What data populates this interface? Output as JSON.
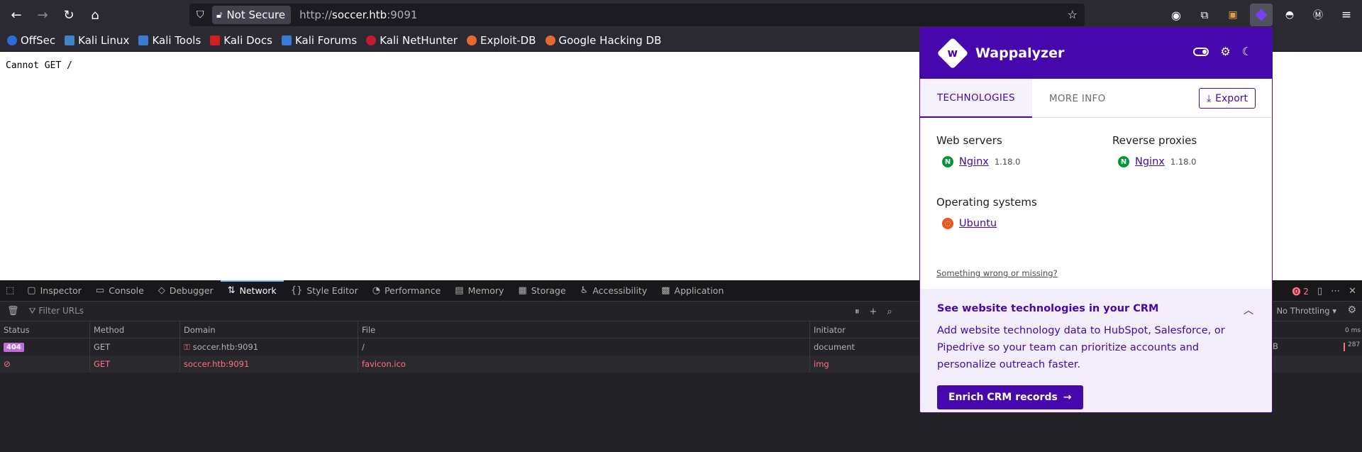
{
  "browser": {
    "security_label": "Not Secure",
    "url_scheme": "http://",
    "url_host": "soccer.htb",
    "url_port": ":9091"
  },
  "bookmarks": [
    {
      "label": "OffSec",
      "color": "#2b6cd8"
    },
    {
      "label": "Kali Linux",
      "color": "#3d85c6"
    },
    {
      "label": "Kali Tools",
      "color": "#3a7bd5"
    },
    {
      "label": "Kali Docs",
      "color": "#d02020"
    },
    {
      "label": "Kali Forums",
      "color": "#3a7bd5"
    },
    {
      "label": "Kali NetHunter",
      "color": "#c21b2d"
    },
    {
      "label": "Exploit-DB",
      "color": "#e86a2a"
    },
    {
      "label": "Google Hacking DB",
      "color": "#e86a2a"
    }
  ],
  "page": {
    "text": "Cannot GET /"
  },
  "devtools": {
    "tabs": [
      {
        "label": "Inspector",
        "icon": "inspector-icon",
        "glyph": "▢"
      },
      {
        "label": "Console",
        "icon": "console-icon",
        "glyph": "▭"
      },
      {
        "label": "Debugger",
        "icon": "debugger-icon",
        "glyph": "◇"
      },
      {
        "label": "Network",
        "icon": "network-icon",
        "glyph": "⇅"
      },
      {
        "label": "Style Editor",
        "icon": "style-editor-icon",
        "glyph": "{}"
      },
      {
        "label": "Performance",
        "icon": "performance-icon",
        "glyph": "◔"
      },
      {
        "label": "Memory",
        "icon": "memory-icon",
        "glyph": "▤"
      },
      {
        "label": "Storage",
        "icon": "storage-icon",
        "glyph": "▦"
      },
      {
        "label": "Accessibility",
        "icon": "accessibility-icon",
        "glyph": "♿"
      },
      {
        "label": "Application",
        "icon": "application-icon",
        "glyph": "▩"
      }
    ],
    "selected_tab": "Network",
    "error_count": "2",
    "filter_placeholder": "Filter URLs",
    "throttling": "No Throttling",
    "waterfall_label": "0 ms",
    "columns": [
      "Status",
      "Method",
      "Domain",
      "File",
      "Initiator"
    ],
    "rows": [
      {
        "status": "404",
        "method": "GET",
        "domain": "soccer.htb:9091",
        "file": "/",
        "initiator": "document",
        "type_tail": "B",
        "size_tail": "287"
      },
      {
        "status": "blocked",
        "method": "GET",
        "domain": "soccer.htb:9091",
        "file": "favicon.ico",
        "initiator": "img"
      }
    ]
  },
  "wappalyzer": {
    "title": "Wappalyzer",
    "tabs": [
      "TECHNOLOGIES",
      "MORE INFO"
    ],
    "export_label": "Export",
    "categories": [
      {
        "name": "Web servers",
        "tech": "Nginx",
        "version": "1.18.0",
        "color": "#009639"
      },
      {
        "name": "Reverse proxies",
        "tech": "Nginx",
        "version": "1.18.0",
        "color": "#009639"
      },
      {
        "name": "Operating systems",
        "tech": "Ubuntu",
        "version": "",
        "color": "#e95420"
      }
    ],
    "wrong_link": "Something wrong or missing?",
    "crm_title": "See website technologies in your CRM",
    "crm_text": "Add website technology data to HubSpot, Salesforce, or Pipedrive so your team can prioritize accounts and personalize outreach faster.",
    "crm_button": "Enrich CRM records"
  }
}
